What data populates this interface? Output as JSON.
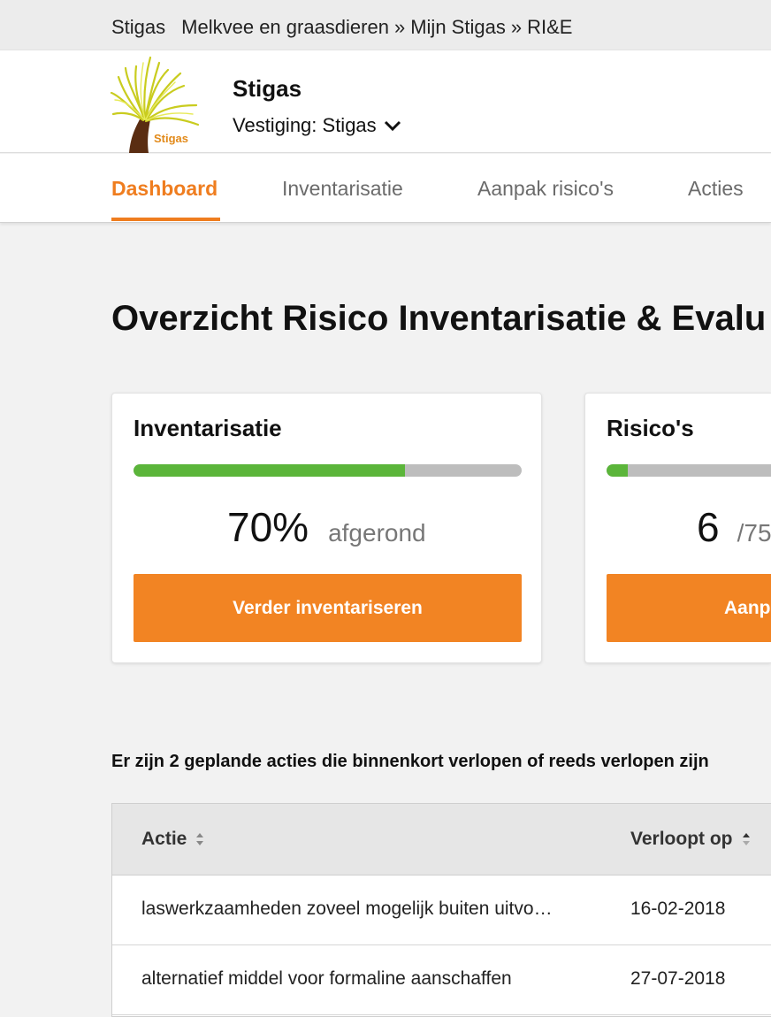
{
  "breadcrumb": {
    "brand": "Stigas",
    "items": [
      "Melkvee en graasdieren",
      "Mijn Stigas",
      "RI&E"
    ],
    "separator": "»"
  },
  "header": {
    "logo_text": "Stigas",
    "org_name": "Stigas",
    "vestiging_label": "Vestiging: Stigas"
  },
  "tabs": [
    {
      "label": "Dashboard",
      "active": true
    },
    {
      "label": "Inventarisatie",
      "active": false
    },
    {
      "label": "Aanpak risico's",
      "active": false
    },
    {
      "label": "Acties",
      "active": false
    }
  ],
  "page_title": "Overzicht Risico Inventarisatie & Evalu",
  "cards": {
    "inventarisatie": {
      "title": "Inventarisatie",
      "progress": 0.7,
      "value": "70%",
      "suffix": "afgerond",
      "button": "Verder inventariseren"
    },
    "risicos": {
      "title": "Risico's",
      "progress": 0.08,
      "value": "6",
      "suffix": "/75",
      "button": "Aanpa"
    }
  },
  "notice": "Er zijn 2 geplande acties die binnenkort verlopen of reeds verlopen zijn",
  "table": {
    "columns": [
      "Actie",
      "Verloopt op"
    ],
    "rows": [
      [
        "laswerkzaamheden zoveel mogelijk buiten uitvo…",
        "16-02-2018"
      ],
      [
        "alternatief middel voor formaline aanschaffen",
        "27-07-2018"
      ]
    ]
  },
  "colors": {
    "accent": "#ef7d1f",
    "button": "#f28423",
    "progress_fill": "#5bb53a",
    "progress_track": "#bdbdbd"
  }
}
